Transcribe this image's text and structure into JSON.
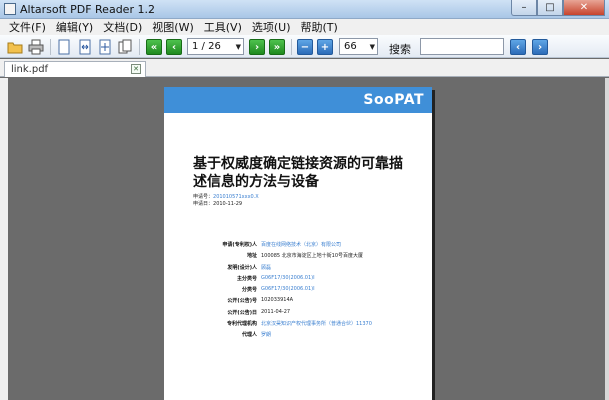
{
  "window": {
    "title": "Altarsoft PDF Reader 1.2",
    "minimize": "–",
    "maximize": "□",
    "close": "✕"
  },
  "menu": [
    "文件(F)",
    "编辑(Y)",
    "文档(D)",
    "视图(W)",
    "工具(V)",
    "选项(U)",
    "帮助(T)"
  ],
  "toolbar": {
    "page_display": "1 / 26",
    "zoom": "66",
    "search_label": "搜索",
    "search_value": ""
  },
  "tab": {
    "label": "link.pdf"
  },
  "document": {
    "brand": "SooPAT",
    "title": "基于权威度确定链接资源的可靠描述信息的方法与设备",
    "meta": [
      {
        "label": "申请号：",
        "value": "201010571xxx0.X"
      },
      {
        "label": "申请日：",
        "value": "2010-11-29"
      }
    ],
    "fields": [
      {
        "label": "申请(专利权)人",
        "value": "百度在线网络技术（北京）有限公司"
      },
      {
        "label": "地址",
        "value": "100085 北京市海淀区上地十街10号百度大厦"
      },
      {
        "label": "发明(设计)人",
        "value": "顾磊"
      },
      {
        "label": "主分类号",
        "value": "G06F17/30(2006.01)I"
      },
      {
        "label": "分类号",
        "value": "G06F17/30(2006.01)I"
      },
      {
        "label": "公开(公告)号",
        "value": "102033914A"
      },
      {
        "label": "公开(公告)日",
        "value": "2011-04-27"
      },
      {
        "label": "专利代理机构",
        "value": "北京汉昊知识产权代理事务所（普通合伙）11370"
      },
      {
        "label": "代理人",
        "value": "罗朗"
      }
    ]
  },
  "colors": {
    "header_blue": "#3f8fd8",
    "link_blue": "#3a7fd0",
    "nav_green": "#1f8a1f"
  }
}
